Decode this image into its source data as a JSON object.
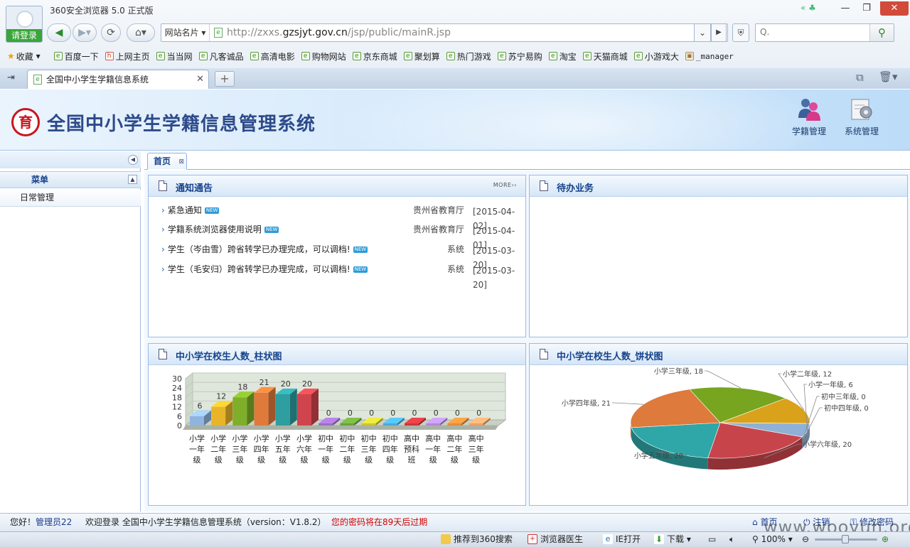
{
  "browser": {
    "title": "360安全浏览器 5.0 正式版",
    "login": "请登录",
    "site_name": "网站名片",
    "url_pre": "http://zxxs.",
    "url_host": "gzsjyt.gov.cn",
    "url_path": "/jsp/public/mainR.jsp",
    "search_placeholder": "Q.",
    "bookmarks": [
      "收藏",
      "百度一下",
      "上网主页",
      "当当网",
      "凡客诚品",
      "高清电影",
      "购物网站",
      "京东商城",
      "聚划算",
      "热门游戏",
      "苏宁易购",
      "淘宝",
      "天猫商城",
      "小游戏大",
      "_manager"
    ],
    "tab_title": "全国中小学生学籍信息系统",
    "status_items": [
      "推荐到360搜索",
      "浏览器医生",
      "IE打开",
      "下载",
      "100%"
    ]
  },
  "page": {
    "system_title": "全国中小学生学籍信息管理系统",
    "logo_char": "育",
    "nav": [
      "学籍管理",
      "系统管理"
    ],
    "sidebar": {
      "menu_title": "菜单",
      "items": [
        "日常管理"
      ]
    },
    "tabs": [
      "首页"
    ],
    "colors": {
      "title": "#2d4a8a",
      "panel_header": "#15428b",
      "logo": "#c8161d",
      "warning": "#d00000"
    }
  },
  "notices": {
    "title": "通知通告",
    "more": "MORE",
    "new_badge": "NEW",
    "items": [
      {
        "text": "紧急通知",
        "source": "贵州省教育厅",
        "date": "[2015-04-02]"
      },
      {
        "text": "学籍系统浏览器使用说明",
        "source": "贵州省教育厅",
        "date": "[2015-04-01]"
      },
      {
        "text": "学生（岑由雪）跨省转学已办理完成，可以调档!",
        "source": "系统",
        "date": "[2015-03-20]"
      },
      {
        "text": "学生（毛安归）跨省转学已办理完成，可以调档!",
        "source": "系统",
        "date": "[2015-03-20]"
      }
    ]
  },
  "todo": {
    "title": "待办业务"
  },
  "bar_panel": {
    "title": "中小学在校生人数_柱状图"
  },
  "pie_panel": {
    "title": "中小学在校生人数_饼状图"
  },
  "chart_data": [
    {
      "type": "bar",
      "categories": [
        "小学一年级",
        "小学二年级",
        "小学三年级",
        "小学四年级",
        "小学五年级",
        "小学六年级",
        "初中一年级",
        "初中二年级",
        "初中三年级",
        "初中四年级",
        "高中预科班",
        "高中一年级",
        "高中二年级",
        "高中三年级"
      ],
      "values": [
        6,
        12,
        18,
        21,
        20,
        20,
        0,
        0,
        0,
        0,
        0,
        0,
        0,
        0
      ],
      "yticks": [
        0,
        6,
        12,
        18,
        24,
        30
      ],
      "ylim": [
        0,
        30
      ],
      "colors": [
        "#8fb4de",
        "#e8b52a",
        "#7fae2a",
        "#e07a3a",
        "#2e9ea0",
        "#d0454d",
        "#9b6fc4",
        "#6aa23e",
        "#c9c534",
        "#4aa8d8",
        "#c8383e",
        "#b08ad4",
        "#e68a3a",
        "#e9a06a"
      ]
    },
    {
      "type": "pie",
      "labels": [
        "小学一年级",
        "小学二年级",
        "小学三年级",
        "小学四年级",
        "小学五年级",
        "小学六年级",
        "初中三年级",
        "初中四年级"
      ],
      "values": [
        6,
        12,
        18,
        21,
        20,
        20,
        0,
        0
      ],
      "display": [
        "小学一年级, 6",
        "小学二年级, 12",
        "小学三年级, 18",
        "小学四年级, 21",
        "小学五年级, 20",
        "小学六年级, 20",
        "初中三年级, 0",
        "初中四年级, 0"
      ],
      "colors": [
        "#8fb1d6",
        "#d9a21a",
        "#77a51f",
        "#dd7a3c",
        "#2fa6a7",
        "#c8444b",
        "#999999",
        "#999999"
      ]
    }
  ],
  "status": {
    "greeting": "您好！",
    "user": "管理员22",
    "welcome": "欢迎登录 全国中小学生学籍信息管理系统（version：V1.8.2）",
    "warning": "您的密码将在89天后过期",
    "links": [
      "首页",
      "注销",
      "修改密码"
    ]
  },
  "watermark": "www.wooyun.org"
}
